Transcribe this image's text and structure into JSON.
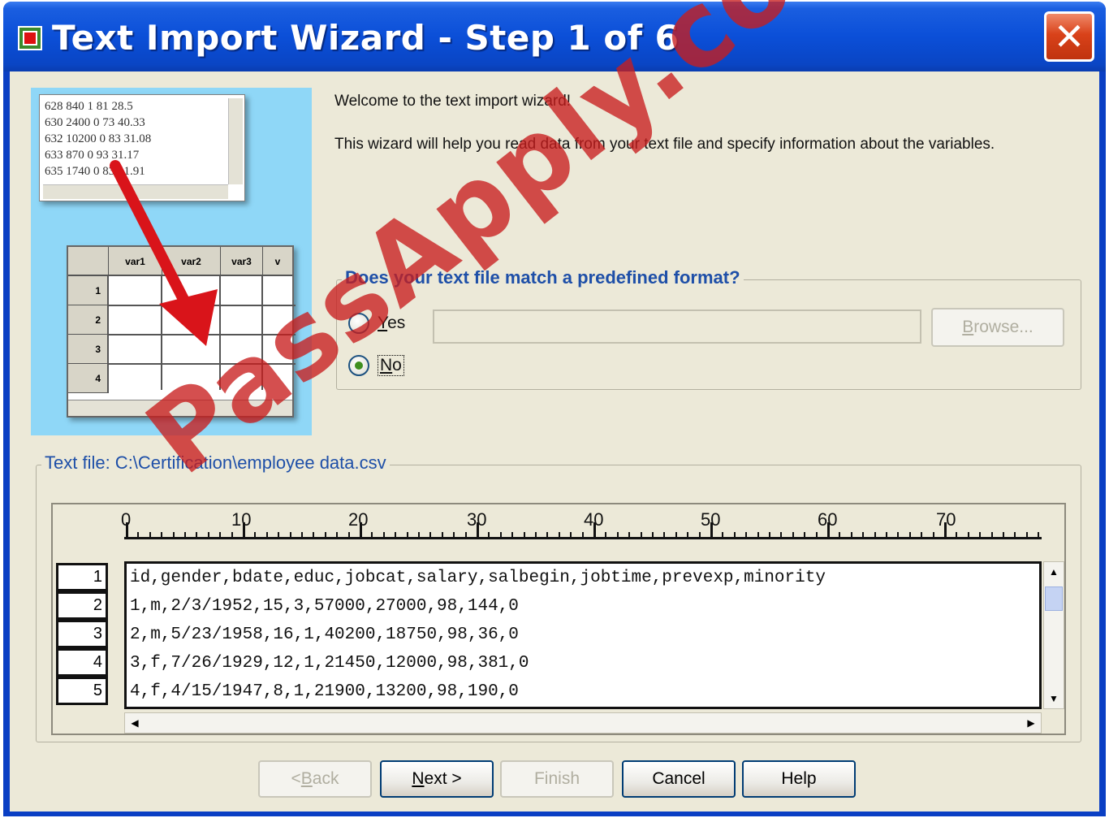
{
  "window": {
    "title": "Text Import Wizard - Step 1 of 6",
    "close_glyph": "✕"
  },
  "illustration": {
    "text_lines": [
      "628 840 1 81 28.5",
      "630 2400 0 73 40.33",
      "632 10200 0 83 31.08",
      "633 870 0 93 31.17",
      "635 1740 0 83 41.91"
    ],
    "columns": [
      "var1",
      "var2",
      "var3",
      "v"
    ],
    "rows": [
      "1",
      "2",
      "3",
      "4"
    ]
  },
  "intro": {
    "welcome": "Welcome to the text import wizard!",
    "description": "This wizard will help you read data from your text file and specify information about the variables."
  },
  "format_group": {
    "legend": "Does your text file match a predefined format?",
    "yes_label_u": "Y",
    "yes_label_rest": "es",
    "no_label_u": "N",
    "no_label_rest": "o",
    "selected": "No",
    "format_path": "",
    "browse_u": "B",
    "browse_rest": "rowse..."
  },
  "text_file": {
    "legend": "Text file:  C:\\Certification\\employee data.csv",
    "ruler": [
      "0",
      "10",
      "20",
      "30",
      "40",
      "50",
      "60",
      "70"
    ],
    "line_numbers": [
      "1",
      "2",
      "3",
      "4",
      "5"
    ],
    "lines": [
      "id,gender,bdate,educ,jobcat,salary,salbegin,jobtime,prevexp,minority",
      "1,m,2/3/1952,15,3,57000,27000,98,144,0",
      "2,m,5/23/1958,16,1,40200,18750,98,36,0",
      "3,f,7/26/1929,12,1,21450,12000,98,381,0",
      "4,f,4/15/1947,8,1,21900,13200,98,190,0"
    ]
  },
  "buttons": {
    "back_pre": "< ",
    "back_u": "B",
    "back_rest": "ack",
    "next_u": "N",
    "next_rest": "ext >",
    "finish": "Finish",
    "cancel": "Cancel",
    "help": "Help"
  },
  "watermark": "PassApply.com",
  "colors": {
    "title_bar": "#0b4fd8",
    "close_button": "#d9421a",
    "group_legend": "#1e4fa8",
    "watermark": "#c81e1e",
    "illustration_bg": "#8fd7f7"
  }
}
